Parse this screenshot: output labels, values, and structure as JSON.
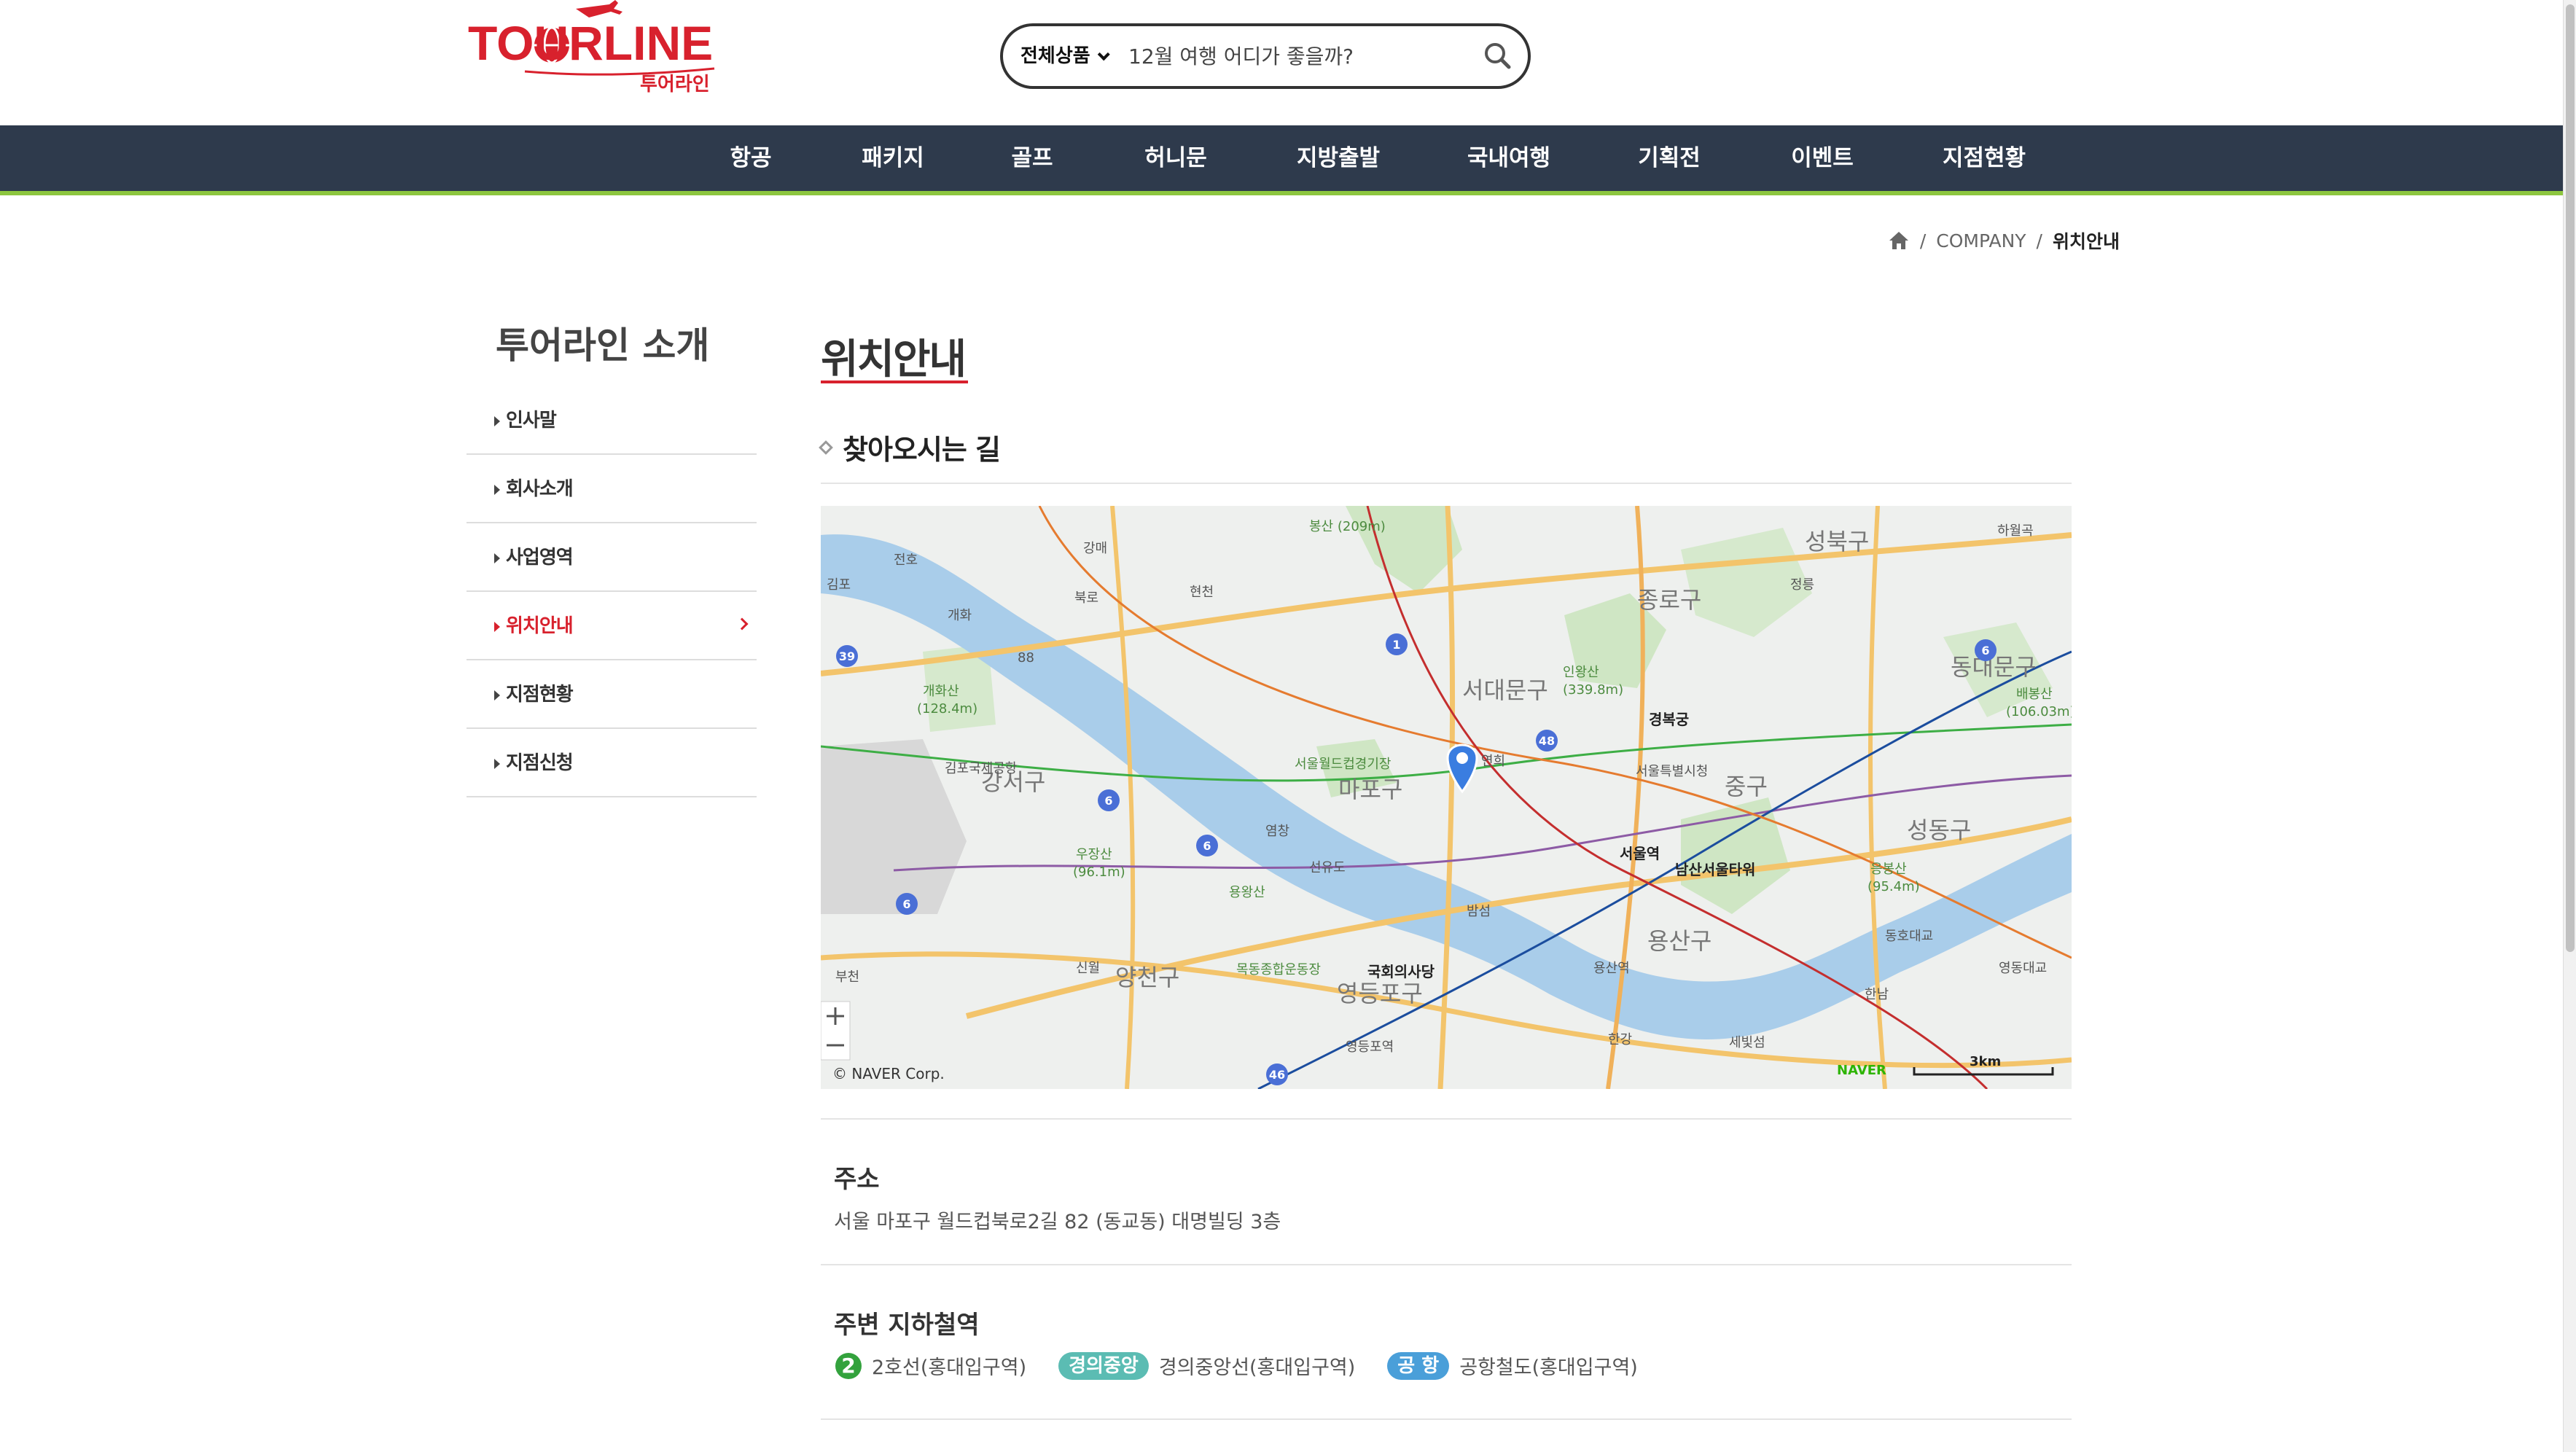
{
  "header": {
    "logo_text": "TOURLINE",
    "logo_subtext": "투어라인",
    "search": {
      "category": "전체상품",
      "placeholder": "12월 여행 어디가 좋을까?"
    }
  },
  "nav": {
    "items": [
      "항공",
      "패키지",
      "골프",
      "허니문",
      "지방출발",
      "국내여행",
      "기획전",
      "이벤트",
      "지점현황"
    ]
  },
  "breadcrumb": {
    "items": [
      "COMPANY",
      "위치안내"
    ],
    "separator": "/"
  },
  "sidebar": {
    "title": "투어라인 소개",
    "items": [
      {
        "label": "인사말",
        "active": false
      },
      {
        "label": "회사소개",
        "active": false
      },
      {
        "label": "사업영역",
        "active": false
      },
      {
        "label": "위치안내",
        "active": true
      },
      {
        "label": "지점현황",
        "active": false
      },
      {
        "label": "지점신청",
        "active": false
      }
    ]
  },
  "main": {
    "title": "위치안내",
    "section_heading": "찾아오시는 길",
    "map": {
      "labels": {
        "seongbuk": "성북구",
        "jongno": "종로구",
        "dongdaemun": "동대문구",
        "seodaemun": "서대문구",
        "mapo": "마포구",
        "gangseo": "강서구",
        "junggu": "중구",
        "seongdong": "성동구",
        "yongsan": "용산구",
        "yangcheon": "양천구",
        "yeongdeungpo": "영등포구",
        "gyeongbokgung": "경복궁",
        "seoul_station": "서울역",
        "namsan_tower": "남산서울타워",
        "national_assembly": "국회의사당",
        "worldcup_stadium": "서울월드컵경기장",
        "gimpo_airport": "김포국제공항",
        "ingwangsan": "인왕산",
        "ingwangsan_h": "(339.8m)",
        "gaehwasan": "개화산",
        "gaehwasan_h": "(128.4m)",
        "ujangsan": "우장산",
        "ujangsan_h": "(96.1m)",
        "baebongsan": "배봉산",
        "baebongsan_h": "(106.03m)",
        "eungbongsan": "응봉산",
        "eungbongsan_h": "(95.4m)",
        "bongsan": "봉산 (209m)",
        "yongwangsan": "용왕산",
        "mokdong": "목동종합운동장",
        "seoul_cityhall": "서울특별시청",
        "jeongneung": "정릉",
        "seonyudo": "선유도",
        "bamseom": "밤섬",
        "yeongdeungpo_station": "영등포역",
        "hangang": "한강",
        "sebitseom": "세빛섬",
        "ic_yeonhui": "연희",
        "ic_gangmae": "강매",
        "ic_jeonho": "전호",
        "ic_gaehwa": "개화",
        "ic_hyeoncheon": "현천",
        "ic_bungno": "북로",
        "jc_88": "88",
        "ic_sinwol": "신월",
        "ic_bucheon": "부천",
        "jc_yeomchang": "염창",
        "ic_hannam": "한남",
        "jc_dongho": "동호대교",
        "jc_yeongdong": "영동대교",
        "ic_haworgok": "하월곡",
        "gimpo": "김포",
        "ic_yongsan": "용산역",
        "copyright": "© NAVER Corp.",
        "scale": "3km",
        "naver": "NAVER",
        "route_1": "1",
        "route_6": "6",
        "route_39": "39",
        "route_48": "48",
        "route_46": "46"
      }
    },
    "address": {
      "title": "주소",
      "text": "서울 마포구 월드컵북로2길 82 (동교동) 대명빌딩 3층"
    },
    "subway": {
      "title": "주변 지하철역",
      "lines": [
        {
          "badge": "2",
          "text": "2호선(홍대입구역)"
        },
        {
          "badge": "경의중앙",
          "text": "경의중앙선(홍대입구역)"
        },
        {
          "badge": "공 항",
          "text": "공항철도(홍대입구역)"
        }
      ]
    }
  },
  "colors": {
    "nav_bg": "#2e3a4c",
    "nav_accent": "#8dc63f",
    "brand_red": "#d8212d",
    "line2": "#33a23d",
    "gyeongui": "#5bbcb3",
    "airport": "#4a9fd9"
  }
}
